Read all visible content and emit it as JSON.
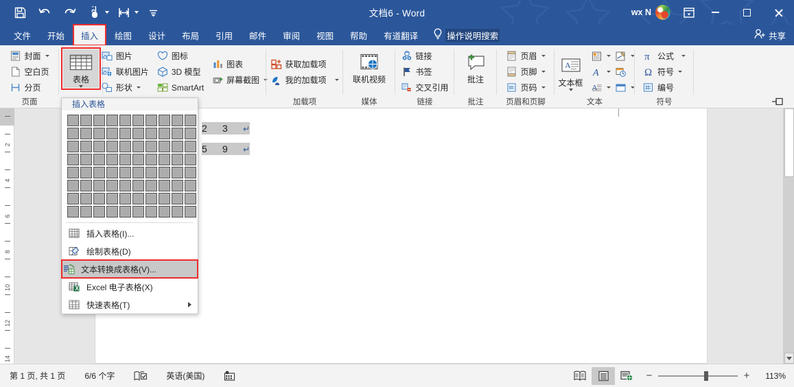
{
  "window": {
    "title": "文档6  -  Word",
    "account_name": "wx N",
    "quick_access": [
      {
        "name": "save-icon",
        "label": "保存"
      },
      {
        "name": "undo-icon",
        "label": "撤消"
      },
      {
        "name": "redo-icon",
        "label": "恢复"
      },
      {
        "name": "touch-mode-icon",
        "label": "触摸/鼠标模式"
      },
      {
        "name": "repeat-icon",
        "label": "重复"
      },
      {
        "name": "customize-qat-icon",
        "label": "自定义快速访问工具栏"
      }
    ],
    "buttons": {
      "ribbon_display": "功能区显示选项",
      "minimize": "最小化",
      "maximize": "最大化",
      "close": "关闭"
    }
  },
  "tabs": [
    {
      "label": "文件",
      "active": false
    },
    {
      "label": "开始",
      "active": false
    },
    {
      "label": "插入",
      "active": true,
      "highlighted": true
    },
    {
      "label": "绘图",
      "active": false
    },
    {
      "label": "设计",
      "active": false
    },
    {
      "label": "布局",
      "active": false
    },
    {
      "label": "引用",
      "active": false
    },
    {
      "label": "邮件",
      "active": false
    },
    {
      "label": "审阅",
      "active": false
    },
    {
      "label": "视图",
      "active": false
    },
    {
      "label": "帮助",
      "active": false
    },
    {
      "label": "有道翻译",
      "active": false
    }
  ],
  "tell_me": {
    "label": "操作说明搜索",
    "icon": "lightbulb-icon"
  },
  "share": {
    "label": "共享",
    "icon": "share-person-icon"
  },
  "ribbon": {
    "groups": [
      {
        "name": "页面",
        "label": "页面",
        "items": [
          {
            "label": "封面",
            "icon": "cover-page-icon",
            "dropdown": true
          },
          {
            "label": "空白页",
            "icon": "blank-page-icon",
            "dropdown": false
          },
          {
            "label": "分页",
            "icon": "page-break-icon",
            "dropdown": false
          }
        ]
      },
      {
        "name": "表格",
        "label": "",
        "big_button": {
          "label": "表格",
          "icon": "table-icon",
          "dropdown": true,
          "highlighted": true,
          "pressed": true
        }
      },
      {
        "name": "插图",
        "label": "",
        "items": [
          {
            "label": "图片",
            "icon": "picture-icon",
            "dropdown": false
          },
          {
            "label": "联机图片",
            "icon": "online-picture-icon",
            "dropdown": false
          },
          {
            "label": "形状",
            "icon": "shapes-icon",
            "dropdown": true
          },
          {
            "label": "图标",
            "icon": "icons-icon",
            "dropdown": false
          },
          {
            "label": "3D 模型",
            "icon": "3d-model-icon",
            "dropdown": false
          },
          {
            "label": "SmartArt",
            "icon": "smartart-icon",
            "dropdown": false
          },
          {
            "label": "图表",
            "icon": "chart-icon",
            "dropdown": false
          },
          {
            "label": "屏幕截图",
            "icon": "screenshot-icon",
            "dropdown": true
          }
        ]
      },
      {
        "name": "加载项",
        "label": "加载项",
        "items": [
          {
            "label": "获取加载项",
            "icon": "get-addins-icon",
            "dropdown": false
          },
          {
            "label": "我的加载项",
            "icon": "my-addins-icon",
            "dropdown": true
          }
        ]
      },
      {
        "name": "媒体",
        "label": "媒体",
        "big_button": {
          "label": "联机视频",
          "icon": "online-video-icon",
          "dropdown": false
        }
      },
      {
        "name": "链接",
        "label": "链接",
        "items": [
          {
            "label": "链接",
            "icon": "link-icon",
            "dropdown": false
          },
          {
            "label": "书签",
            "icon": "bookmark-icon",
            "dropdown": false
          },
          {
            "label": "交叉引用",
            "icon": "cross-reference-icon",
            "dropdown": false
          }
        ]
      },
      {
        "name": "批注",
        "label": "批注",
        "big_button": {
          "label": "批注",
          "icon": "new-comment-icon",
          "dropdown": false
        }
      },
      {
        "name": "页眉和页脚",
        "label": "页眉和页脚",
        "items": [
          {
            "label": "页眉",
            "icon": "header-icon",
            "dropdown": true
          },
          {
            "label": "页脚",
            "icon": "footer-icon",
            "dropdown": true
          },
          {
            "label": "页码",
            "icon": "page-number-icon",
            "dropdown": true
          }
        ]
      },
      {
        "name": "文本",
        "label": "文本",
        "big_button": {
          "label": "文本框",
          "icon": "text-box-icon",
          "dropdown": true
        },
        "items": [
          {
            "label": "",
            "icon": "quick-parts-icon",
            "dropdown": true
          },
          {
            "label": "",
            "icon": "signature-line-icon",
            "dropdown": true
          },
          {
            "label": "",
            "icon": "wordart-icon",
            "dropdown": true
          },
          {
            "label": "",
            "icon": "date-time-icon",
            "dropdown": false
          },
          {
            "label": "",
            "icon": "drop-cap-icon",
            "dropdown": true
          },
          {
            "label": "",
            "icon": "object-icon",
            "dropdown": true
          }
        ]
      },
      {
        "name": "符号",
        "label": "符号",
        "items": [
          {
            "label": "公式",
            "icon": "equation-icon",
            "dropdown": true
          },
          {
            "label": "符号",
            "icon": "symbol-icon",
            "dropdown": true
          },
          {
            "label": "编号",
            "icon": "number-icon",
            "dropdown": false
          }
        ]
      }
    ],
    "collapse_icon": "collapse-ribbon-icon"
  },
  "table_menu": {
    "header": "插入表格",
    "grid": {
      "cols": 10,
      "rows": 8
    },
    "items": [
      {
        "label": "插入表格(I)...",
        "icon": "insert-table-icon",
        "accel": "I",
        "selected": false,
        "highlighted": false,
        "submenu": false
      },
      {
        "label": "绘制表格(D)",
        "icon": "draw-table-icon",
        "accel": "D",
        "selected": false,
        "highlighted": false,
        "submenu": false
      },
      {
        "label": "文本转换成表格(V)...",
        "icon": "convert-text-to-table-icon",
        "accel": "V",
        "selected": true,
        "highlighted": true,
        "submenu": false
      },
      {
        "label": "Excel 电子表格(X)",
        "icon": "excel-spreadsheet-icon",
        "accel": "X",
        "selected": false,
        "highlighted": false,
        "submenu": false
      },
      {
        "label": "快速表格(T)",
        "icon": "quick-tables-icon",
        "accel": "T",
        "selected": false,
        "highlighted": false,
        "submenu": true
      }
    ]
  },
  "document": {
    "lines": [
      {
        "cells": [
          "2",
          "3"
        ],
        "pilcrow": "↵",
        "selected": true
      },
      {
        "cells": [
          "5",
          "9"
        ],
        "pilcrow": "↵",
        "selected": true
      }
    ],
    "ruler_ticks": [
      "2",
      "4",
      "6",
      "8",
      "10",
      "12",
      "14"
    ]
  },
  "status_bar": {
    "page_info": "第 1 页, 共 1 页",
    "word_count": "6/6 个字",
    "proofing_icon": "proofing-icon",
    "language": "英语(美国)",
    "accessibility_icon": "accessibility-icon",
    "views": [
      {
        "name": "read-mode-view",
        "label": "阅读视图",
        "active": false
      },
      {
        "name": "print-layout-view",
        "label": "页面视图",
        "active": true
      },
      {
        "name": "web-layout-view",
        "label": "Web 版式视图",
        "active": false
      }
    ],
    "zoom_out": "−",
    "zoom_in": "+",
    "zoom_level": "113%"
  }
}
